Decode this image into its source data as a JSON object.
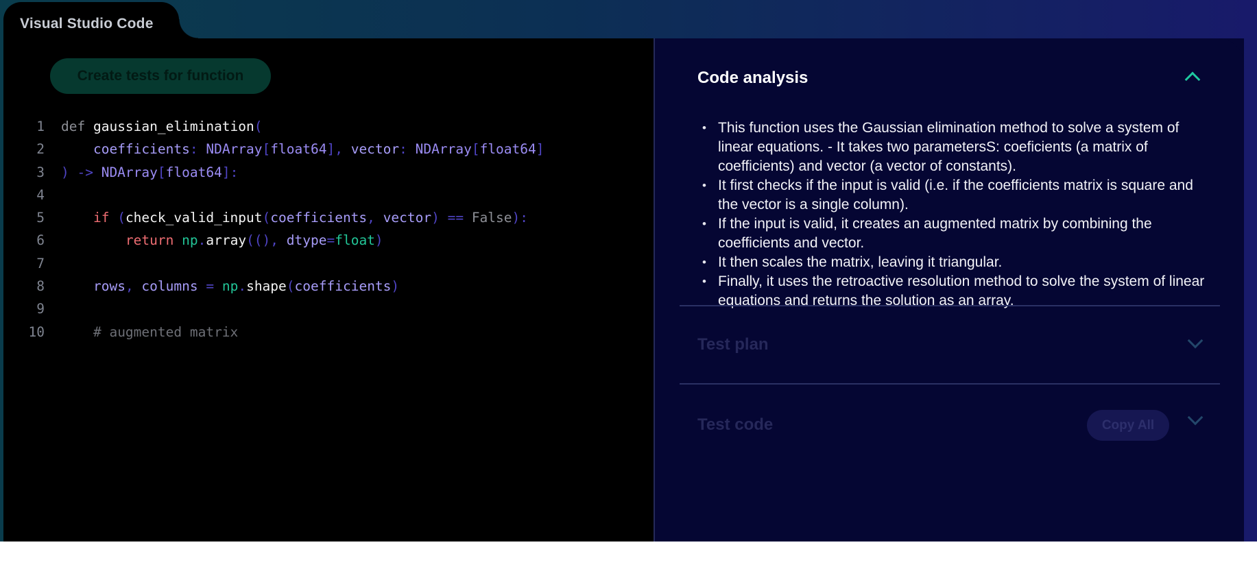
{
  "window": {
    "title": "Visual Studio Code"
  },
  "editor": {
    "create_button_label": "Create tests for function",
    "lines": [
      {
        "n": "1",
        "tokens": [
          {
            "t": "def ",
            "c": "kw"
          },
          {
            "t": "gaussian_elimination",
            "c": "fn"
          },
          {
            "t": "(",
            "c": "pn"
          }
        ]
      },
      {
        "n": "2",
        "tokens": [
          {
            "t": "    ",
            "c": "kw"
          },
          {
            "t": "coefficients",
            "c": "pa"
          },
          {
            "t": ": ",
            "c": "pn"
          },
          {
            "t": "NDArray",
            "c": "ty"
          },
          {
            "t": "[",
            "c": "pn"
          },
          {
            "t": "float64",
            "c": "ty"
          },
          {
            "t": "], ",
            "c": "pn"
          },
          {
            "t": "vector",
            "c": "pa"
          },
          {
            "t": ": ",
            "c": "pn"
          },
          {
            "t": "NDArray",
            "c": "ty"
          },
          {
            "t": "[",
            "c": "pn"
          },
          {
            "t": "float64",
            "c": "ty"
          },
          {
            "t": "]",
            "c": "pn"
          }
        ]
      },
      {
        "n": "3",
        "tokens": [
          {
            "t": ") -> ",
            "c": "pn"
          },
          {
            "t": "NDArray",
            "c": "ty"
          },
          {
            "t": "[",
            "c": "pn"
          },
          {
            "t": "float64",
            "c": "ty"
          },
          {
            "t": "]:",
            "c": "pn"
          }
        ]
      },
      {
        "n": "4",
        "tokens": []
      },
      {
        "n": "5",
        "tokens": [
          {
            "t": "    ",
            "c": "kw"
          },
          {
            "t": "if",
            "c": "rd"
          },
          {
            "t": " (",
            "c": "pn"
          },
          {
            "t": "check_valid_input",
            "c": "fn"
          },
          {
            "t": "(",
            "c": "pn"
          },
          {
            "t": "coefficients",
            "c": "pa"
          },
          {
            "t": ", ",
            "c": "pn"
          },
          {
            "t": "vector",
            "c": "pa"
          },
          {
            "t": ") == ",
            "c": "pn"
          },
          {
            "t": "False",
            "c": "kw"
          },
          {
            "t": "):",
            "c": "pn"
          }
        ]
      },
      {
        "n": "6",
        "tokens": [
          {
            "t": "        ",
            "c": "kw"
          },
          {
            "t": "return",
            "c": "rd"
          },
          {
            "t": " ",
            "c": "kw"
          },
          {
            "t": "np",
            "c": "gr"
          },
          {
            "t": ".",
            "c": "pn"
          },
          {
            "t": "array",
            "c": "fn"
          },
          {
            "t": "((), ",
            "c": "pn"
          },
          {
            "t": "dtype",
            "c": "pa"
          },
          {
            "t": "=",
            "c": "pn"
          },
          {
            "t": "float",
            "c": "gr"
          },
          {
            "t": ")",
            "c": "pn"
          }
        ]
      },
      {
        "n": "7",
        "tokens": []
      },
      {
        "n": "8",
        "tokens": [
          {
            "t": "    ",
            "c": "kw"
          },
          {
            "t": "rows",
            "c": "pa"
          },
          {
            "t": ", ",
            "c": "pn"
          },
          {
            "t": "columns",
            "c": "pa"
          },
          {
            "t": " = ",
            "c": "pn"
          },
          {
            "t": "np",
            "c": "gr"
          },
          {
            "t": ".",
            "c": "pn"
          },
          {
            "t": "shape",
            "c": "fn"
          },
          {
            "t": "(",
            "c": "pn"
          },
          {
            "t": "coefficients",
            "c": "pa"
          },
          {
            "t": ")",
            "c": "pn"
          }
        ]
      },
      {
        "n": "9",
        "tokens": []
      },
      {
        "n": "10",
        "tokens": [
          {
            "t": "    ",
            "c": "kw"
          },
          {
            "t": "# augmented matrix",
            "c": "cm"
          }
        ]
      }
    ]
  },
  "panel": {
    "analysis": {
      "title": "Code analysis",
      "expanded": true,
      "bullets": [
        "This function uses the Gaussian elimination method to solve a system of linear equations. - It takes two parametersS: coeficients (a matrix of coefficients) and vector (a vector of constants).",
        "It first checks if the input is valid (i.e. if the coefficients matrix is square and the vector is a single column).",
        "If the input is valid, it creates an augmented matrix by combining the coefficients and vector.",
        "It then scales the matrix, leaving it triangular.",
        "Finally, it uses the retroactive resolution method to solve the system of linear equations and returns the solution as an array."
      ]
    },
    "test_plan": {
      "title": "Test plan",
      "expanded": false
    },
    "test_code": {
      "title": "Test code",
      "expanded": false,
      "copy_label": "Copy All"
    }
  },
  "icons": {
    "analysis_toggle": "chevron-up-icon",
    "test_plan_toggle": "chevron-down-icon",
    "test_code_toggle": "chevron-down-icon"
  },
  "colors": {
    "accent": "#1ec9a0",
    "panel_bg": "#050633",
    "editor_bg": "#000000"
  }
}
